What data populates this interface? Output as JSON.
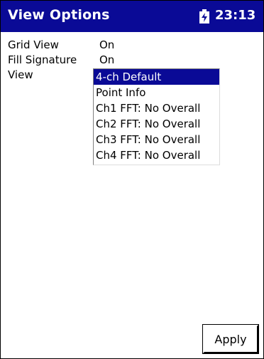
{
  "titlebar": {
    "title": "View Options",
    "battery_icon": "battery-icon",
    "time": "23:13"
  },
  "options": {
    "grid_view": {
      "label": "Grid View",
      "value": "On"
    },
    "fill_signature": {
      "label": "Fill Signature",
      "value": "On"
    },
    "view": {
      "label": "View",
      "selected": "4-ch Default",
      "items": [
        "4-ch Default",
        "Point Info",
        "Ch1 FFT: No Overall",
        "Ch2 FFT: No Overall",
        "Ch3 FFT: No Overall",
        "Ch4 FFT: No Overall"
      ]
    }
  },
  "footer": {
    "apply_label": "Apply"
  },
  "colors": {
    "titlebar_bg": "#0a0a96",
    "selection_bg": "#0a0a96",
    "background": "#ffffff"
  }
}
